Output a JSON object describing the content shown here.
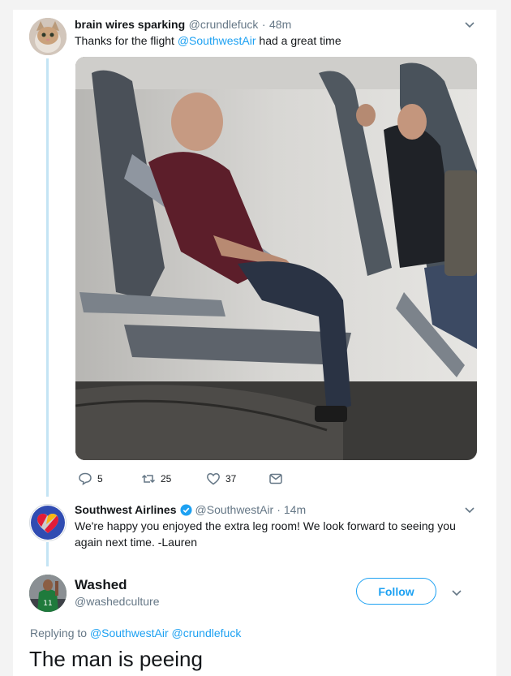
{
  "tweet1": {
    "display_name": "brain wires sparking",
    "handle": "@crundlefuck",
    "sep": "·",
    "time": "48m",
    "text_before": "Thanks for the flight ",
    "mention": "@SouthwestAir",
    "text_after": " had a great time",
    "actions": {
      "replies": "5",
      "retweets": "25",
      "likes": "37"
    }
  },
  "tweet2": {
    "display_name": "Southwest Airlines",
    "handle": "@SouthwestAir",
    "sep": "·",
    "time": "14m",
    "line1": "We're happy you enjoyed the extra leg room! We look forward to seeing you",
    "line2": "again next time. -Lauren"
  },
  "tweet3": {
    "display_name": "Washed",
    "handle": "@washedculture",
    "follow_label": "Follow",
    "replying_prefix": "Replying to ",
    "replying_to": "@SouthwestAir @crundlefuck",
    "text": "The man is peeing"
  },
  "icons": [
    "chevron-down-icon",
    "reply-icon",
    "retweet-icon",
    "like-icon",
    "message-icon",
    "verified-badge-icon"
  ],
  "colors": {
    "link": "#1da1f2",
    "muted": "#657786",
    "thread_line": "#c4e4f4"
  }
}
